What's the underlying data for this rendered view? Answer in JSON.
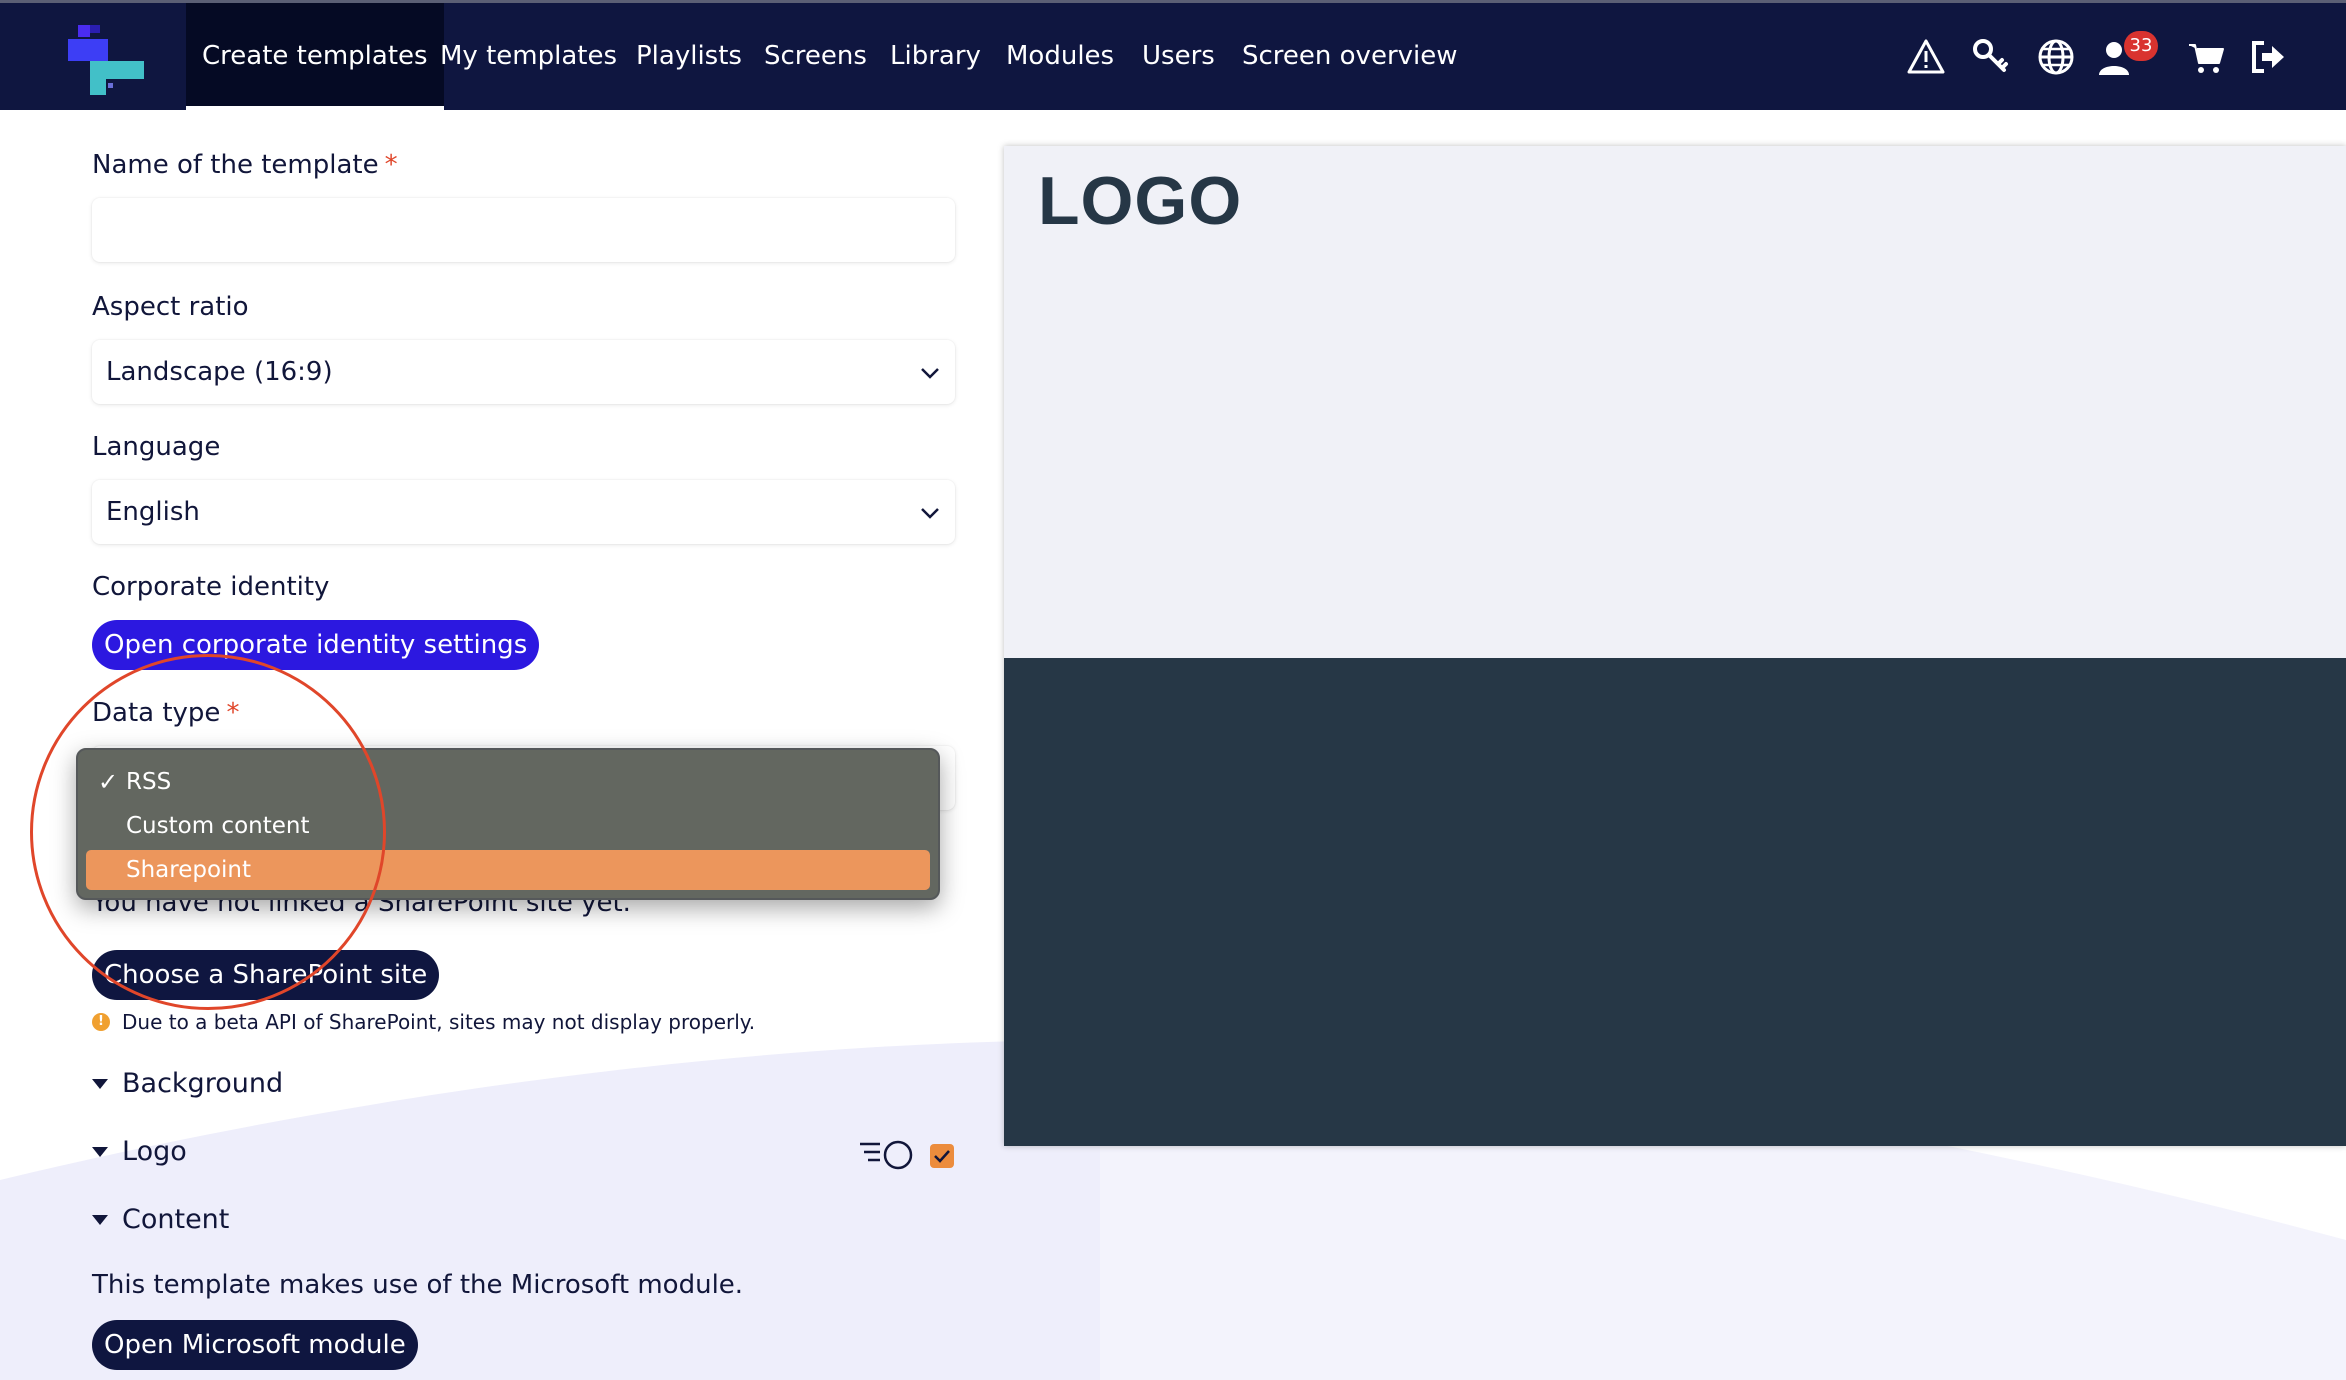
{
  "nav": {
    "tabs": [
      {
        "label": "Create templates",
        "active": true
      },
      {
        "label": "My templates"
      },
      {
        "label": "Playlists"
      },
      {
        "label": "Screens"
      },
      {
        "label": "Library"
      },
      {
        "label": "Modules"
      },
      {
        "label": "Users"
      },
      {
        "label": "Screen overview"
      }
    ],
    "icons": [
      "warning-icon",
      "key-icon",
      "globe-icon",
      "user-icon",
      "cart-icon",
      "logout-icon"
    ],
    "user_badge_count": "33"
  },
  "form": {
    "name_label": "Name of the template",
    "required_mark": "*",
    "name_value": "",
    "aspect_label": "Aspect ratio",
    "aspect_value": "Landscape (16:9)",
    "language_label": "Language",
    "language_value": "English",
    "corporate_label": "Corporate identity",
    "corporate_button": "Open corporate identity settings",
    "data_type_label": "Data type",
    "data_type_options": [
      {
        "label": "RSS",
        "checked": true
      },
      {
        "label": "Custom content"
      },
      {
        "label": "Sharepoint",
        "highlighted": true
      }
    ],
    "sharepoint_notice": "You have not linked a SharePoint site yet.",
    "sharepoint_button": "Choose a SharePoint site",
    "beta_warning": "Due to a beta API of SharePoint, sites may not display properly.",
    "sections": [
      "Background",
      "Logo",
      "Content"
    ],
    "logo_checkbox_checked": true,
    "module_note": "This template makes use of the Microsoft module.",
    "module_button": "Open Microsoft module"
  },
  "preview": {
    "logo_text": "LOGO"
  },
  "colors": {
    "nav_bg": "#0f1640",
    "accent_blue": "#2c18e0",
    "orange": "#ec965c",
    "preview_dark": "#263746",
    "annotation_red": "#e0462a"
  }
}
